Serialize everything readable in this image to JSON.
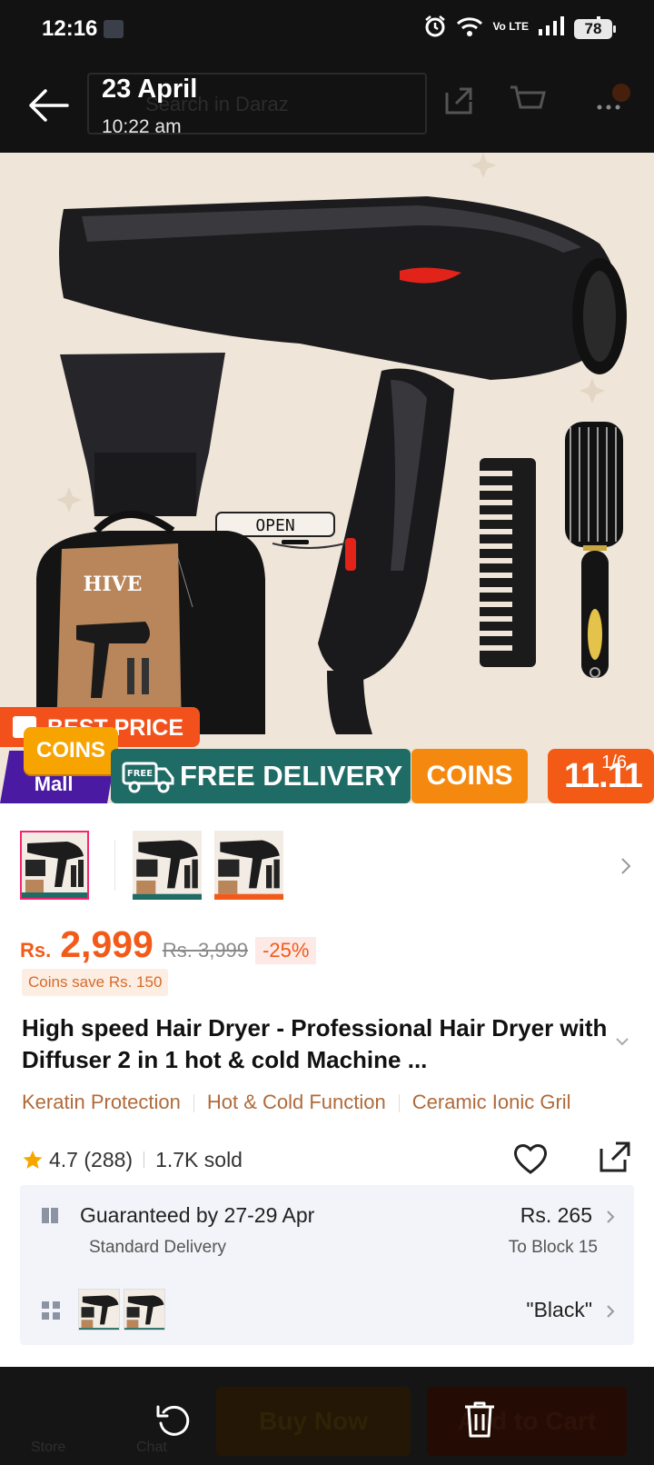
{
  "status_bar": {
    "time": "12:16",
    "volte": "Vo LTE",
    "battery": "78"
  },
  "viewer": {
    "date": "23 April",
    "time": "10:22 am"
  },
  "background_app": {
    "search_placeholder": "Search in Daraz",
    "buy_now": "Buy Now",
    "add_to_cart": "Add to Cart",
    "store_label": "Store",
    "chat_label": "Chat"
  },
  "product_image": {
    "counter": "1/6",
    "best_price": "BEST PRICE",
    "coins_badge": "COINS",
    "mall": "Mall",
    "free_tag": "FREE",
    "free_delivery": "FREE DELIVERY",
    "coins_pill": "COINS",
    "sale_tag": "11.11",
    "brand_bag": "HIVE",
    "open_label": "OPEN"
  },
  "price": {
    "currency": "Rs.",
    "amount": "2,999",
    "original": "Rs. 3,999",
    "discount": "-25%",
    "coins_save": "Coins save Rs. 150"
  },
  "product": {
    "title": "High speed Hair Dryer - Professional Hair Dryer with Diffuser 2 in 1 hot & cold Machine ...",
    "features": [
      "Keratin Protection",
      "Hot & Cold Function",
      "Ceramic Ionic Gril"
    ],
    "rating": "4.7",
    "reviews": "(288)",
    "sold": "1.7K sold"
  },
  "delivery": {
    "guarantee": "Guaranteed by 27-29 Apr",
    "method": "Standard Delivery",
    "fee": "Rs. 265",
    "location": "To Block 15",
    "variant": "\"Black\""
  },
  "colors": {
    "accent": "#f25a1a",
    "teal": "#1f6c66",
    "pink": "#f5266f",
    "dark": "#121212"
  }
}
